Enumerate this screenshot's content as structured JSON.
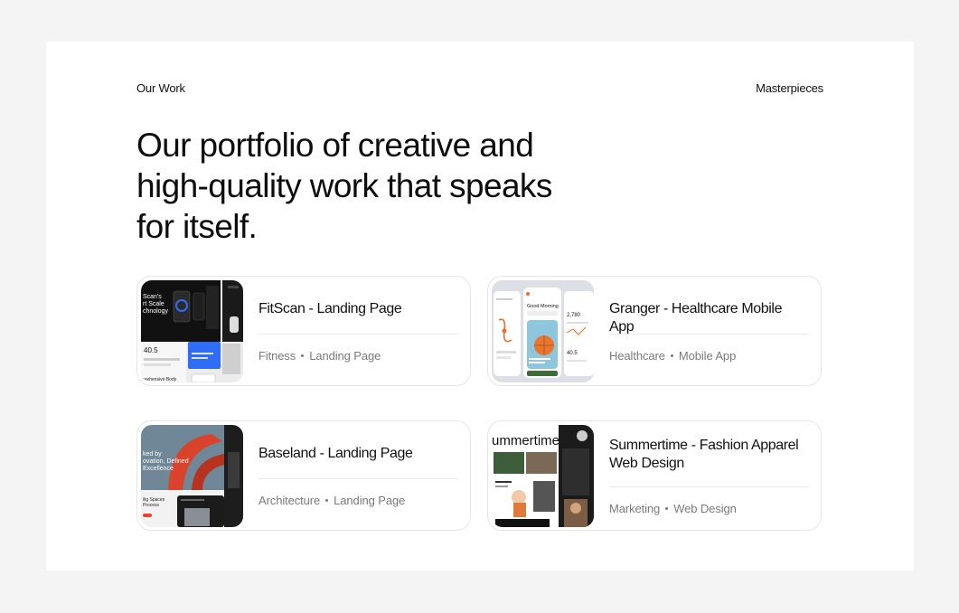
{
  "header": {
    "left_label": "Our Work",
    "right_label": "Masterpieces",
    "headline": "Our portfolio of creative and high-quality work that speaks for itself."
  },
  "projects": [
    {
      "title": "FitScan - Landing Page",
      "tag1": "Fitness",
      "tag2": "Landing Page",
      "thumb_text": [
        "Scan's",
        "rt Scale",
        "chnology",
        "40.5",
        "prehensive Body"
      ]
    },
    {
      "title": "Granger - Healthcare Mobile App",
      "tag1": "Healthcare",
      "tag2": "Mobile App",
      "thumb_text": [
        "Good Morning",
        "2,780",
        "40.5"
      ]
    },
    {
      "title": "Baseland - Landing Page",
      "tag1": "Architecture",
      "tag2": "Landing Page",
      "thumb_text": [
        "ked by",
        "ovation, Defined",
        "Excellence",
        "ilig Spaces",
        "Process"
      ]
    },
    {
      "title": "Summertime - Fashion Apparel Web Design",
      "tag1": "Marketing",
      "tag2": "Web Design",
      "thumb_text": [
        "ummertime"
      ]
    }
  ],
  "colors": {
    "page_bg": "#f4f4f4",
    "panel_bg": "#ffffff",
    "card_border": "#e6e6e6",
    "text_primary": "#111111",
    "text_muted": "#7a7a7a",
    "accent_blue": "#2f6df6",
    "accent_orange": "#f26b2a",
    "accent_red": "#e8452c"
  }
}
